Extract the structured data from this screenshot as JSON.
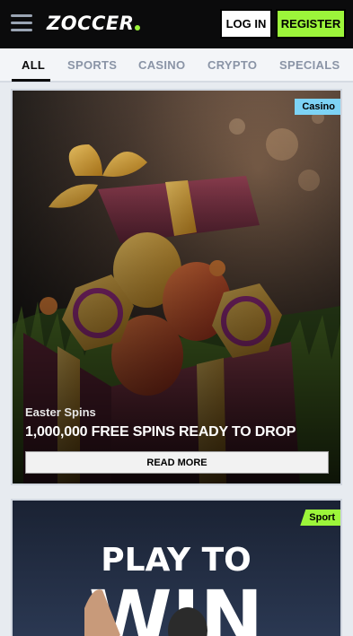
{
  "header": {
    "logo_text": "ZOCCER",
    "login_label": "LOG IN",
    "register_label": "REGISTER"
  },
  "tabs": [
    {
      "label": "ALL",
      "active": true
    },
    {
      "label": "SPORTS",
      "active": false
    },
    {
      "label": "CASINO",
      "active": false
    },
    {
      "label": "CRYPTO",
      "active": false
    },
    {
      "label": "SPECIALS",
      "active": false
    }
  ],
  "promos": [
    {
      "badge": "Casino",
      "label": "Easter Spins",
      "title": "1,000,000 FREE SPINS READY TO DROP",
      "button": "READ MORE"
    },
    {
      "badge": "Sport",
      "art_text_1": "PLAY TO",
      "art_text_2": "WIN"
    }
  ],
  "colors": {
    "brand_green": "#9cf53a",
    "casino_badge": "#7dd3f5",
    "header_bg": "#0b0b0c"
  },
  "icons": {
    "menu": "hamburger-menu-icon"
  }
}
